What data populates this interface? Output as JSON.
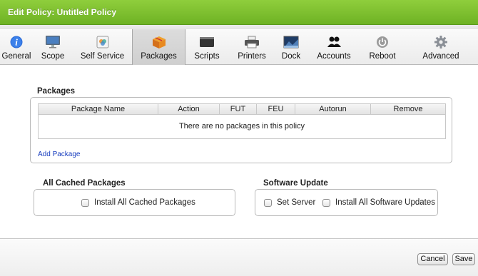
{
  "window": {
    "title": "Edit Policy: Untitled Policy"
  },
  "tabs": [
    {
      "label": "General",
      "icon": "info-icon"
    },
    {
      "label": "Scope",
      "icon": "monitor-icon"
    },
    {
      "label": "Self Service",
      "icon": "self-service-icon"
    },
    {
      "label": "Packages",
      "icon": "package-icon",
      "active": true
    },
    {
      "label": "Scripts",
      "icon": "script-icon"
    },
    {
      "label": "Printers",
      "icon": "printer-icon"
    },
    {
      "label": "Dock",
      "icon": "dock-icon"
    },
    {
      "label": "Accounts",
      "icon": "accounts-icon"
    },
    {
      "label": "Reboot",
      "icon": "power-icon"
    },
    {
      "label": "Advanced",
      "icon": "gear-icon"
    }
  ],
  "packages": {
    "title": "Packages",
    "columns": [
      "Package Name",
      "Action",
      "FUT",
      "FEU",
      "Autorun",
      "Remove"
    ],
    "empty_message": "There are no packages in this policy",
    "add_link": "Add Package"
  },
  "cached": {
    "title": "All Cached Packages",
    "install_all": "Install All Cached Packages"
  },
  "software_update": {
    "title": "Software Update",
    "set_server": "Set Server",
    "install_all": "Install All Software Updates"
  },
  "footer": {
    "cancel": "Cancel",
    "save": "Save"
  },
  "colors": {
    "titlebar": "#7cc02e",
    "link": "#1a3fbf"
  }
}
